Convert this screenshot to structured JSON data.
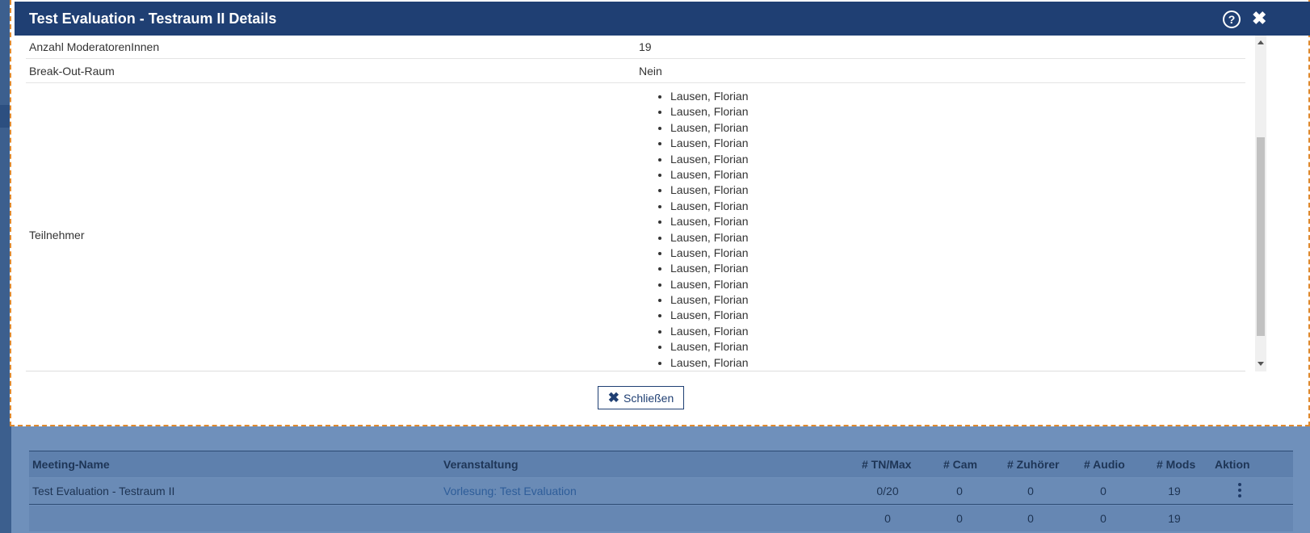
{
  "modal": {
    "title": "Test Evaluation - Testraum II Details",
    "help_icon": "?",
    "close_icon": "✖",
    "rows": [
      {
        "label": "Anzahl ModeratorenInnen",
        "value": "19"
      },
      {
        "label": "Break-Out-Raum",
        "value": "Nein"
      }
    ],
    "participants_label": "Teilnehmer",
    "participants": [
      "Lausen, Florian",
      "Lausen, Florian",
      "Lausen, Florian",
      "Lausen, Florian",
      "Lausen, Florian",
      "Lausen, Florian",
      "Lausen, Florian",
      "Lausen, Florian",
      "Lausen, Florian",
      "Lausen, Florian",
      "Lausen, Florian",
      "Lausen, Florian",
      "Lausen, Florian",
      "Lausen, Florian",
      "Lausen, Florian",
      "Lausen, Florian",
      "Lausen, Florian",
      "Lausen, Florian"
    ],
    "close_button": {
      "icon": "✖",
      "label": "Schließen"
    }
  },
  "background_table": {
    "headers": [
      "Meeting-Name",
      "Veranstaltung",
      "# TN/Max",
      "# Cam",
      "# Zuhörer",
      "# Audio",
      "# Mods",
      "Aktion"
    ],
    "row1": {
      "name": "Test Evaluation - Testraum II",
      "event": "Vorlesung: Test Evaluation",
      "tn": "0/20",
      "cam": "0",
      "zuhoerer": "0",
      "audio": "0",
      "mods": "19"
    },
    "row2": {
      "tn": "0",
      "cam": "0",
      "zuhoerer": "0",
      "audio": "0",
      "mods": "19"
    }
  },
  "colors": {
    "header": "#1f3f73",
    "focus_outline": "#e08a2e"
  }
}
